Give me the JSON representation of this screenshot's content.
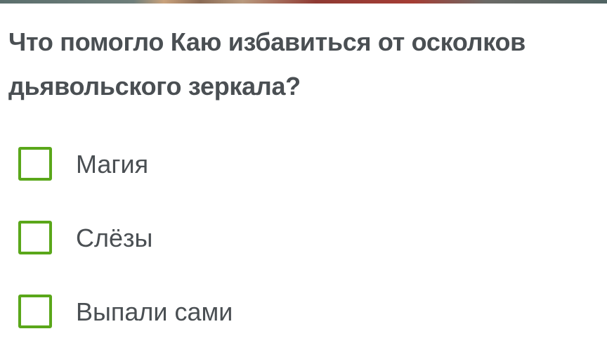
{
  "question": {
    "text": "Что помогло Каю избавиться от осколков дьявольского зеркала?"
  },
  "options": [
    {
      "label": "Магия",
      "checked": false
    },
    {
      "label": "Слёзы",
      "checked": false
    },
    {
      "label": "Выпали сами",
      "checked": false
    }
  ],
  "colors": {
    "checkbox_border": "#5aa71a",
    "text": "#4a4f53"
  }
}
